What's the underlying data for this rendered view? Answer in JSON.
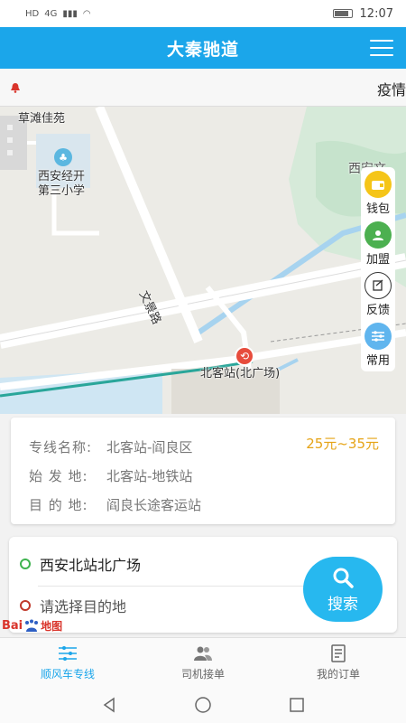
{
  "status": {
    "network": "4G",
    "time": "12:07"
  },
  "header": {
    "title": "大秦驰道"
  },
  "notice": {
    "text": "疫情"
  },
  "map": {
    "labels": {
      "residence": "草滩佳苑",
      "school_line1": "西安经开",
      "school_line2": "第三小学",
      "road": "文景路",
      "station": "北客站(北广场)",
      "park": "西安文"
    }
  },
  "side_tools": [
    {
      "label": "钱包",
      "icon": "wallet-icon",
      "color": "#f5c518"
    },
    {
      "label": "加盟",
      "icon": "join-icon",
      "color": "#4cb050"
    },
    {
      "label": "反馈",
      "icon": "feedback-icon",
      "color": "#ffffff"
    },
    {
      "label": "常用",
      "icon": "sliders-icon",
      "color": "#60b5ee"
    }
  ],
  "route": {
    "line_key": "专线名称:",
    "line_value": "北客站-阎良区",
    "start_key": "始 发 地:",
    "start_value": "北客站-地铁站",
    "dest_key": "目 的 地:",
    "dest_value": "阎良长途客运站",
    "price": "25元~35元"
  },
  "search": {
    "origin": "西安北站北广场",
    "destination_placeholder": "请选择目的地",
    "button_label": "搜索"
  },
  "baidu": {
    "text": "Bai",
    "text2": "地图"
  },
  "tabs": [
    {
      "label": "顺风车专线",
      "active": true
    },
    {
      "label": "司机接单",
      "active": false
    },
    {
      "label": "我的订单",
      "active": false
    }
  ],
  "colors": {
    "accent": "#1ba6ea",
    "price": "#e6a417",
    "origin_dot": "#3fb34f",
    "dest_dot": "#c0392b"
  }
}
